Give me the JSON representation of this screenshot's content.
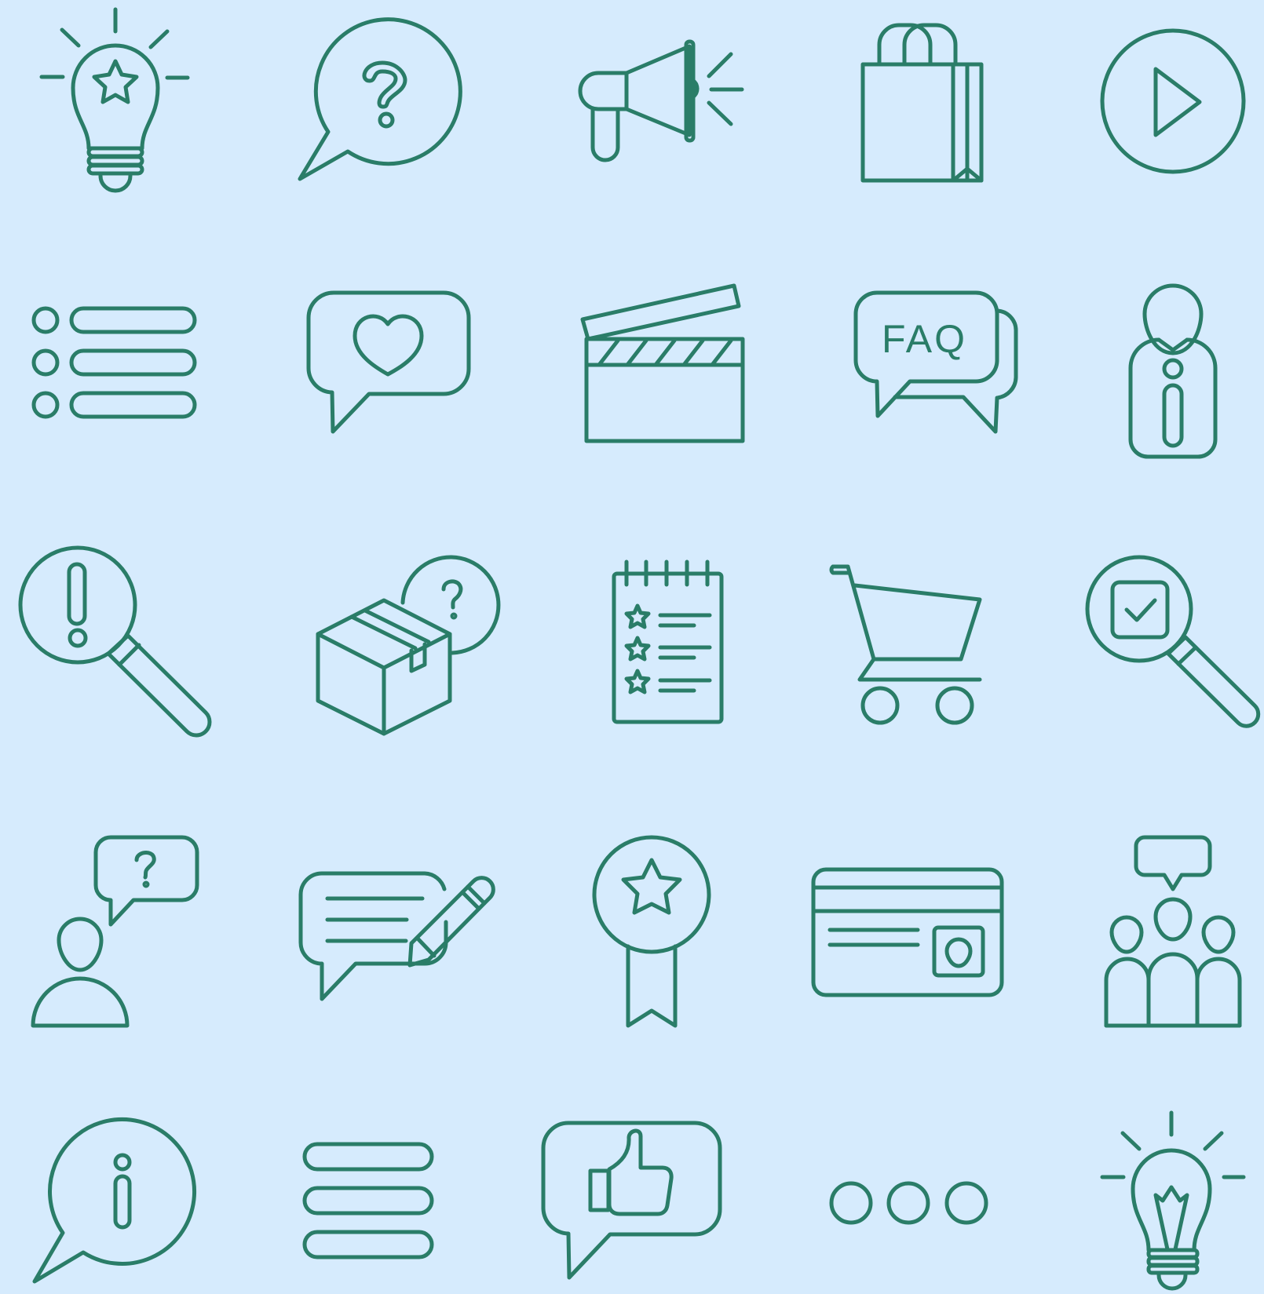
{
  "theme": {
    "background": "#d6ebfd",
    "stroke": "#2a7d68"
  },
  "icons": [
    "lightbulb-star-icon",
    "question-chat-icon",
    "megaphone-icon",
    "shopping-bag-icon",
    "play-button-icon",
    "list-icon",
    "heart-chat-icon",
    "clapperboard-icon",
    "faq-chat-icon",
    "person-info-icon",
    "search-alert-icon",
    "package-question-icon",
    "rated-checklist-icon",
    "shopping-cart-icon",
    "search-check-icon",
    "person-question-icon",
    "chat-edit-icon",
    "award-ribbon-icon",
    "credit-card-icon",
    "group-chat-icon",
    "info-chat-icon",
    "menu-lines-icon",
    "thumbs-up-chat-icon",
    "ellipsis-icon",
    "lightbulb-idea-icon"
  ],
  "faq_label": "FAQ"
}
